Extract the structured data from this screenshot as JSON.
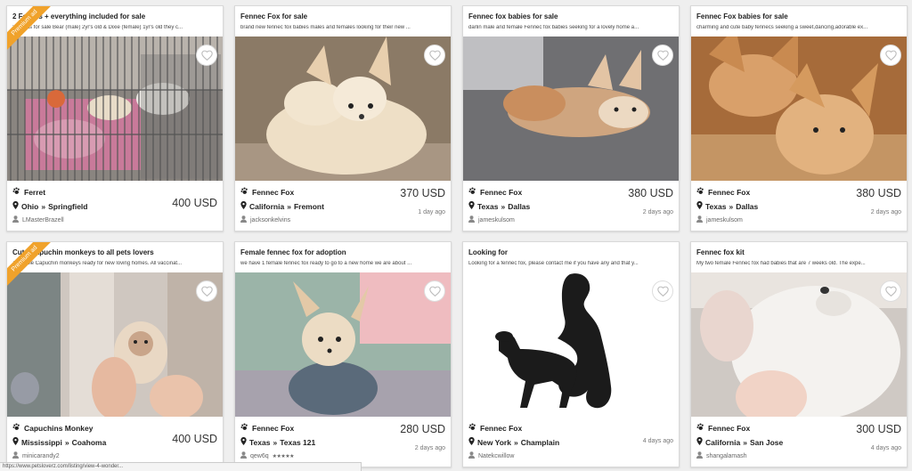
{
  "cards": [
    {
      "title": "2 Ferrets + everything included for sale",
      "desc": "2 ferrets for sale Bear (male) 2yr's old & Dixie (female) 1yr's old they c...",
      "premium": "Premium ad",
      "category": "Ferret",
      "state": "Ohio",
      "city": "Springfield",
      "user": "LMasterBrazell",
      "price": "400 USD",
      "date": ""
    },
    {
      "title": "Fennec Fox for sale",
      "desc": "brand new fennec fox babies males and females looking for their new ...",
      "premium": "",
      "category": "Fennec Fox",
      "state": "California",
      "city": "Fremont",
      "user": "jacksonkelvins",
      "price": "370 USD",
      "date": "1 day ago"
    },
    {
      "title": "Fennec fox babies for sale",
      "desc": "darlin male and female Fennec fox babies seeking for a lovely home a...",
      "premium": "",
      "category": "Fennec Fox",
      "state": "Texas",
      "city": "Dallas",
      "user": "jameskulsom",
      "price": "380 USD",
      "date": "2 days ago"
    },
    {
      "title": "Fennec Fox babies for sale",
      "desc": "charming and cute baby fennecs seeking a sweet,dancing,adorable ex...",
      "premium": "",
      "category": "Fennec Fox",
      "state": "Texas",
      "city": "Dallas",
      "user": "jameskulsom",
      "price": "380 USD",
      "date": "2 days ago"
    },
    {
      "title": "Cute Capuchin monkeys to all pets lovers",
      "desc": "Adorable Capuchin monkeys ready for new loving homes. All vaccinat...",
      "premium": "Premium ad",
      "category": "Capuchins Monkey",
      "state": "Mississippi",
      "city": "Coahoma",
      "user": "minicarandy2",
      "price": "400 USD",
      "date": ""
    },
    {
      "title": "Female fennec fox for adoption",
      "desc": "we have 1 female fennec fox ready to go to a new home we are about ...",
      "premium": "",
      "category": "Fennec Fox",
      "state": "Texas",
      "city": "Texas 121",
      "user": "qew6q",
      "stars": "★★★★★",
      "price": "280 USD",
      "date": "2 days ago"
    },
    {
      "title": "Looking for",
      "desc": "Looking for a fennec fox, please contact me if you have any and that y...",
      "premium": "",
      "category": "Fennec Fox",
      "state": "New York",
      "city": "Champlain",
      "user": "Natekcwillow",
      "price": "",
      "date": "4 days ago"
    },
    {
      "title": "Fennec fox kit",
      "desc": "My two female Fennec fox had babies that are 7 weeks old. The expe...",
      "premium": "",
      "category": "Fennec Fox",
      "state": "California",
      "city": "San Jose",
      "user": "shangalamash",
      "price": "300 USD",
      "date": "4 days ago"
    }
  ],
  "separator": "»",
  "statusbar": "https://www.petsloverz.com/listing/view-4-wonder..."
}
